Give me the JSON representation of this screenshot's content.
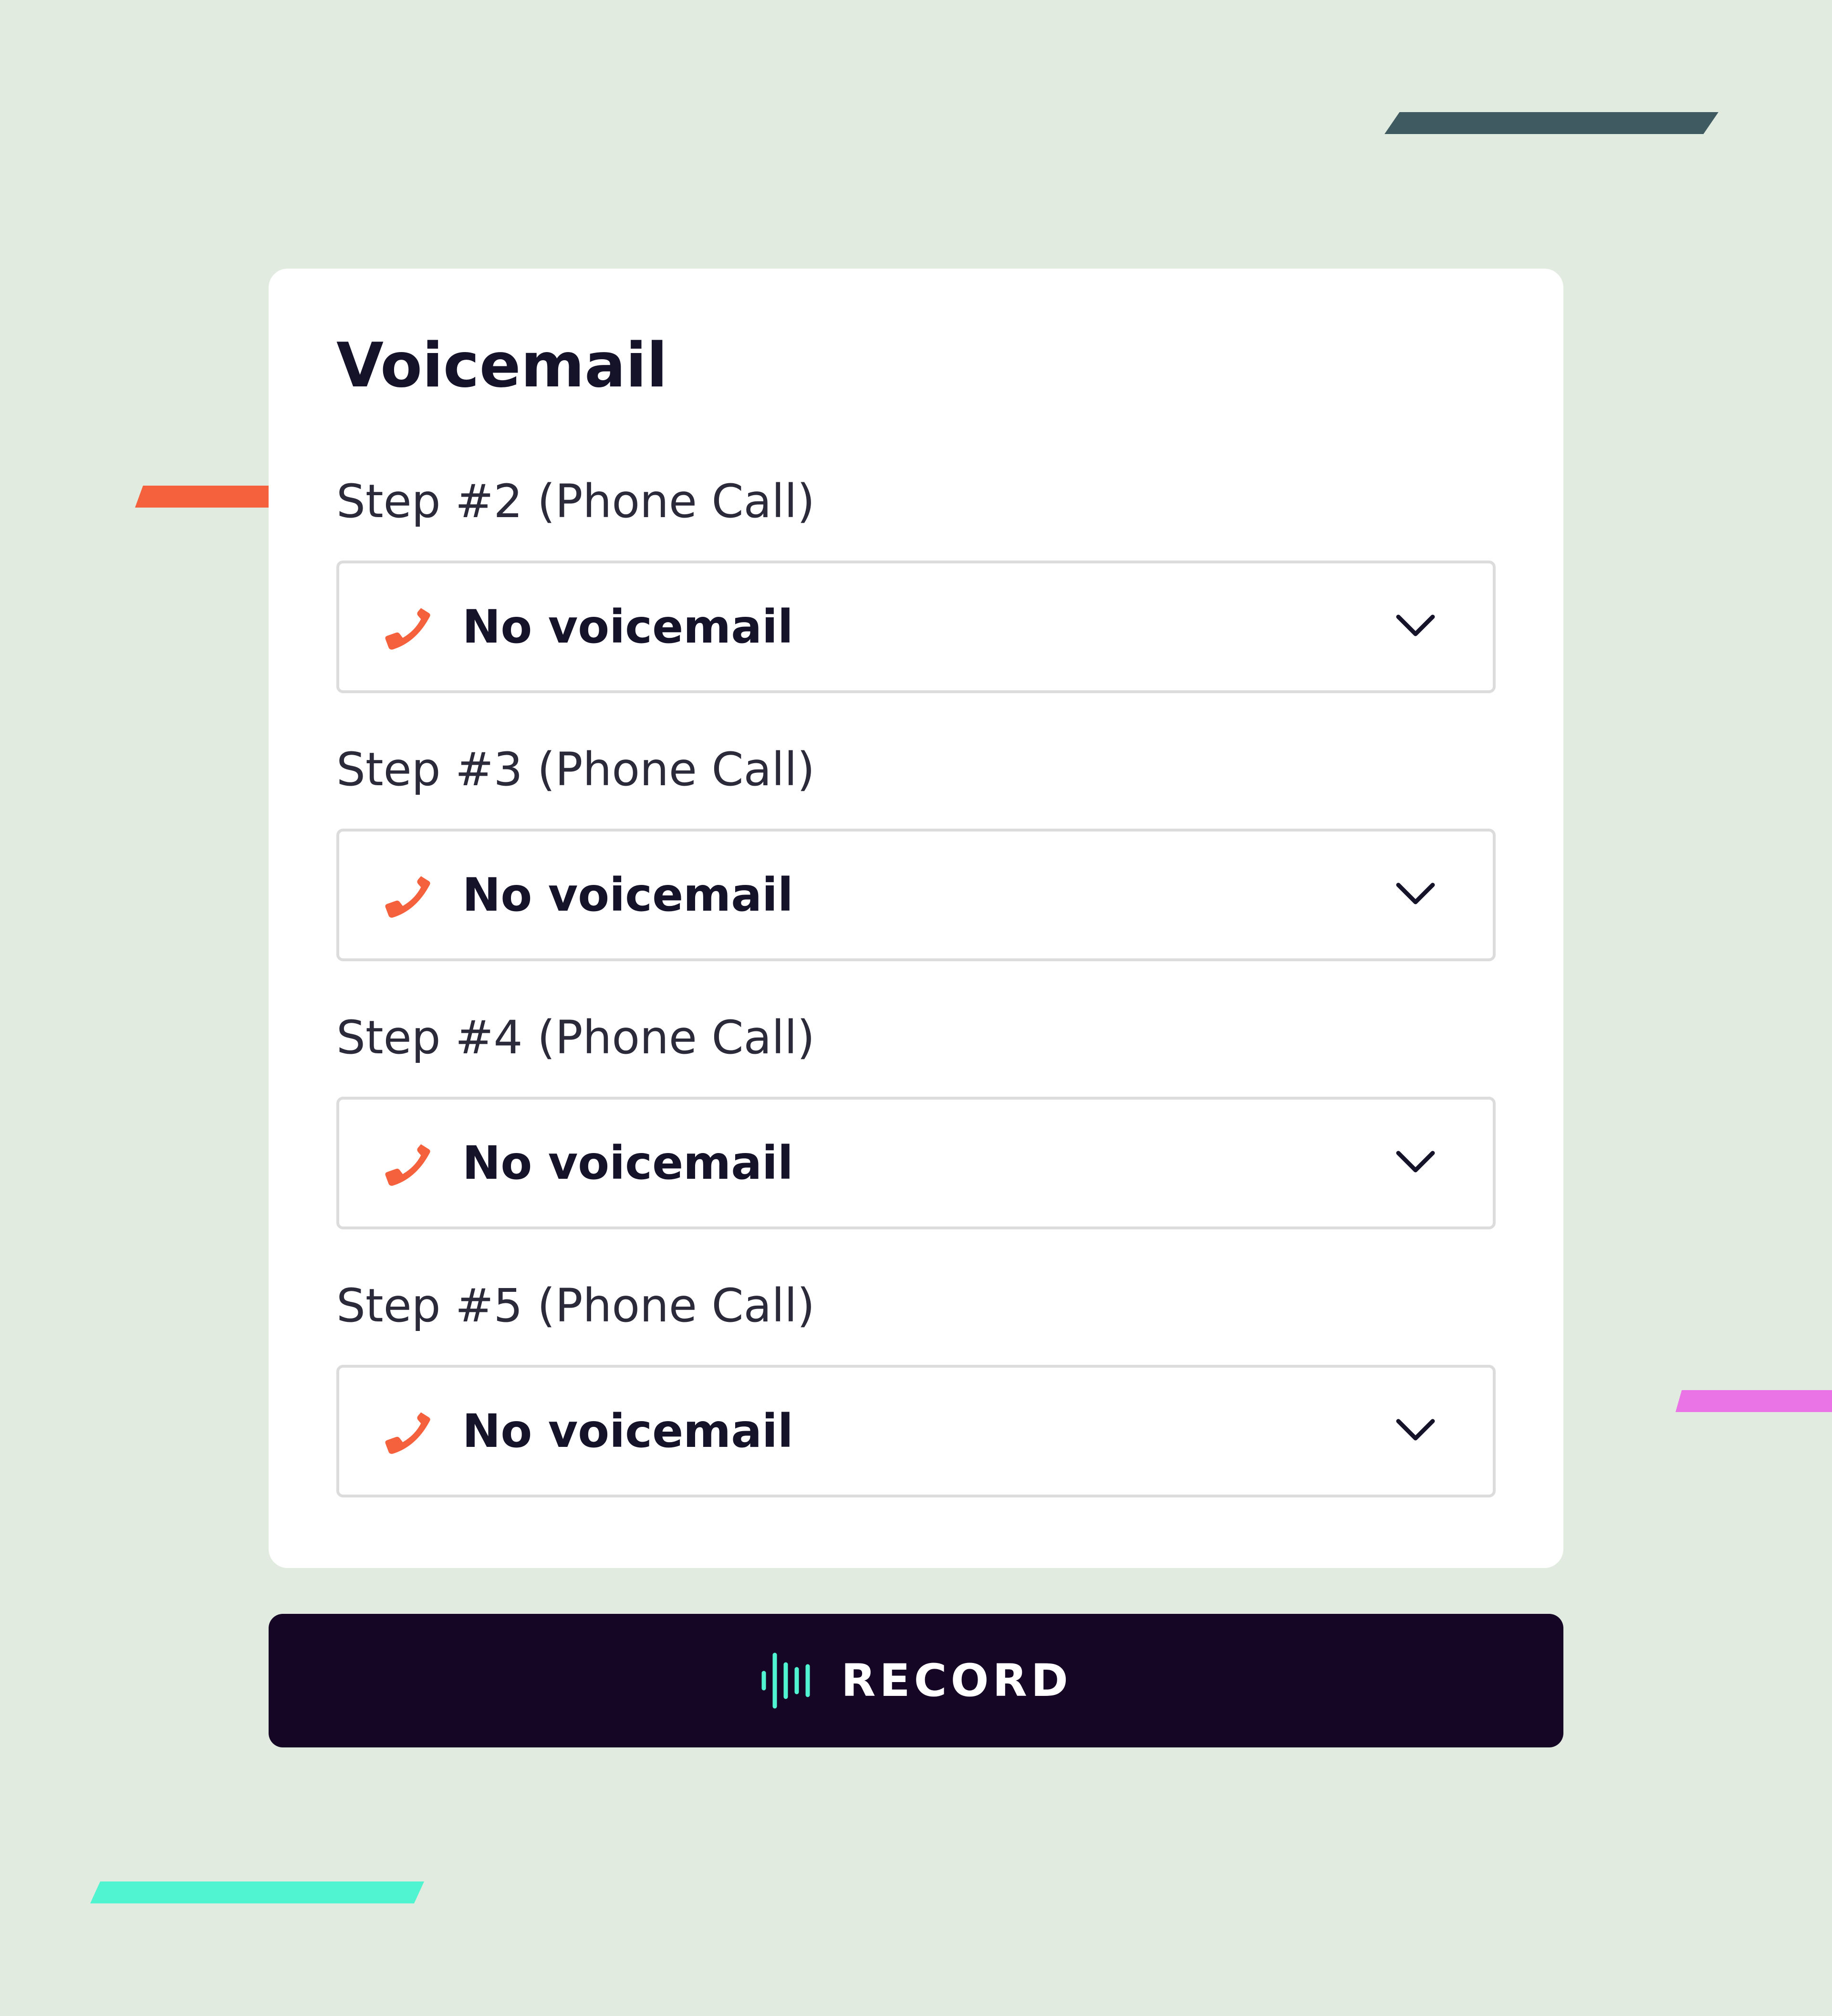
{
  "card": {
    "title": "Voicemail",
    "steps": [
      {
        "label": "Step #2 (Phone Call)",
        "value": "No voicemail"
      },
      {
        "label": "Step #3 (Phone Call)",
        "value": "No voicemail"
      },
      {
        "label": "Step #4 (Phone Call)",
        "value": "No voicemail"
      },
      {
        "label": "Step #5 (Phone Call)",
        "value": "No voicemail"
      }
    ]
  },
  "record_button": {
    "label": "RECORD",
    "icon": "sound-wave-icon"
  },
  "icons": {
    "select": "phone-icon",
    "dropdown": "chevron-down-icon"
  },
  "colors": {
    "background": "#e1ebdf",
    "card": "#ffffff",
    "accent_phone": "#f5613d",
    "button_bg": "#150625",
    "wave_icon": "#50f4d0",
    "deco_dark": "#3f5a60",
    "deco_orange": "#f5613d",
    "deco_pink": "#ea74e5",
    "deco_teal": "#50f4d0"
  }
}
